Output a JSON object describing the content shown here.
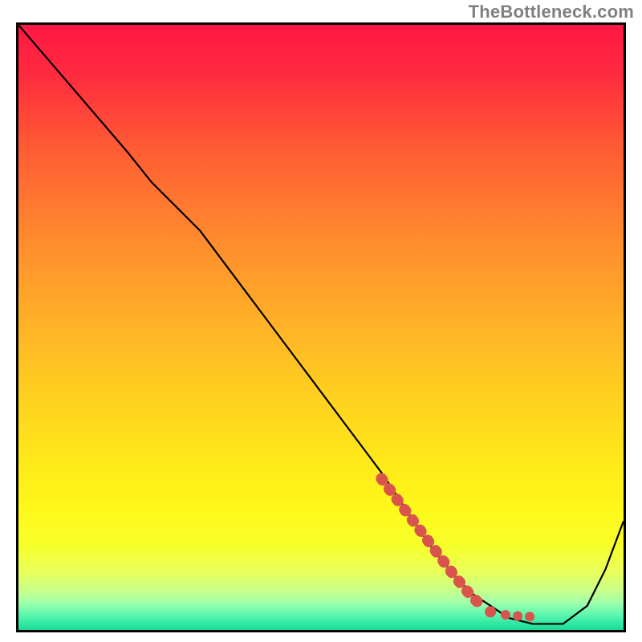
{
  "watermark": "TheBottleneck.com",
  "chart_data": {
    "type": "line",
    "title": "",
    "xlabel": "",
    "ylabel": "",
    "xlim": [
      0,
      100
    ],
    "ylim": [
      0,
      100
    ],
    "grid": false,
    "legend": false,
    "background_gradient": {
      "stops": [
        {
          "offset": 0.0,
          "color": "#ff1744"
        },
        {
          "offset": 0.08,
          "color": "#ff2a3f"
        },
        {
          "offset": 0.2,
          "color": "#ff5a34"
        },
        {
          "offset": 0.35,
          "color": "#ff8a2e"
        },
        {
          "offset": 0.5,
          "color": "#ffb327"
        },
        {
          "offset": 0.62,
          "color": "#ffd21f"
        },
        {
          "offset": 0.72,
          "color": "#ffe81a"
        },
        {
          "offset": 0.8,
          "color": "#fff81a"
        },
        {
          "offset": 0.86,
          "color": "#f7ff2a"
        },
        {
          "offset": 0.905,
          "color": "#e8ff5c"
        },
        {
          "offset": 0.935,
          "color": "#c8ff8a"
        },
        {
          "offset": 0.955,
          "color": "#9fffab"
        },
        {
          "offset": 0.975,
          "color": "#5cf7b0"
        },
        {
          "offset": 0.99,
          "color": "#2fe7a1"
        },
        {
          "offset": 1.0,
          "color": "#1fd895"
        }
      ]
    },
    "series": [
      {
        "name": "bottleneck-curve",
        "color": "#000000",
        "x": [
          0,
          6,
          12,
          18,
          22,
          26,
          30,
          36,
          42,
          48,
          54,
          60,
          64,
          68,
          72,
          75,
          78,
          81,
          85,
          90,
          94,
          97,
          100
        ],
        "y": [
          100,
          93,
          86,
          79,
          74,
          70,
          66,
          58,
          50,
          42,
          34,
          26,
          20,
          14,
          9,
          6,
          4,
          2,
          1,
          1,
          4,
          10,
          18
        ]
      }
    ],
    "highlight_segment": {
      "name": "dotted-highlight",
      "color": "#d9544d",
      "x": [
        60,
        63,
        66,
        69,
        72,
        74.5,
        76.5,
        78,
        80.5,
        82.5,
        84.5
      ],
      "y": [
        25,
        21,
        17,
        13,
        9,
        6,
        4,
        3,
        2.5,
        2.3,
        2.2
      ]
    }
  }
}
